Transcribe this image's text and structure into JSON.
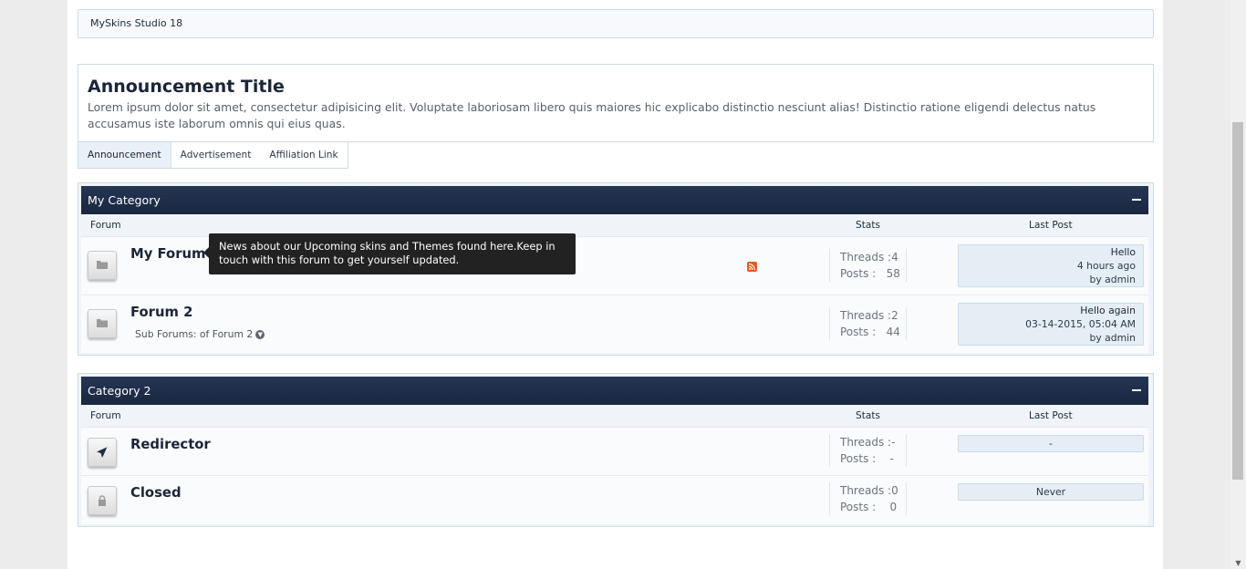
{
  "breadcrumb": {
    "items": [
      "MySkins Studio 18"
    ]
  },
  "notice": {
    "title": "Announcement Title",
    "text": "Lorem ipsum dolor sit amet, consectetur adipisicing elit. Voluptate laboriosam libero quis maiores hic explicabo distinctio nesciunt alias! Distinctio ratione eligendi delectus natus accusamus iste laborum omnis qui eius quas.",
    "tabs": [
      "Announcement",
      "Advertisement",
      "Affiliation Link"
    ]
  },
  "columns": {
    "forum": "Forum",
    "stats": "Stats",
    "last_post": "Last Post"
  },
  "categories": [
    {
      "title": "My Category",
      "forums": [
        {
          "name": "My Forum",
          "icon": "folder-icon",
          "threads": "Threads :4",
          "posts_label": "Posts :",
          "posts": "58",
          "last_title": "Hello",
          "last_time": "4 hours ago",
          "last_by": "by admin",
          "rss": true
        },
        {
          "name": "Forum 2",
          "icon": "folder-icon",
          "subforums": "Sub Forums: of Forum 2",
          "threads": "Threads :2",
          "posts_label": "Posts :",
          "posts": "44",
          "last_title": "Hello again",
          "last_time": "03-14-2015, 05:04 AM",
          "last_by": "by admin"
        }
      ]
    },
    {
      "title": "Category 2",
      "forums": [
        {
          "name": "Redirector",
          "icon": "paper-plane-icon",
          "threads": "Threads :-",
          "posts_label": "Posts :",
          "posts": "-",
          "last_post": "-"
        },
        {
          "name": "Closed",
          "icon": "lock-icon",
          "threads": "Threads :0",
          "posts_label": "Posts :",
          "posts": "0",
          "last_post": "Never"
        }
      ]
    }
  ],
  "tooltip": {
    "text": "News about our Upcoming skins and Themes found here.Keep in touch with this forum to get yourself updated."
  },
  "colors": {
    "header_bg": "#1f2d47",
    "accent_rss": "#e25c1e",
    "page_bg": "#ececec"
  }
}
